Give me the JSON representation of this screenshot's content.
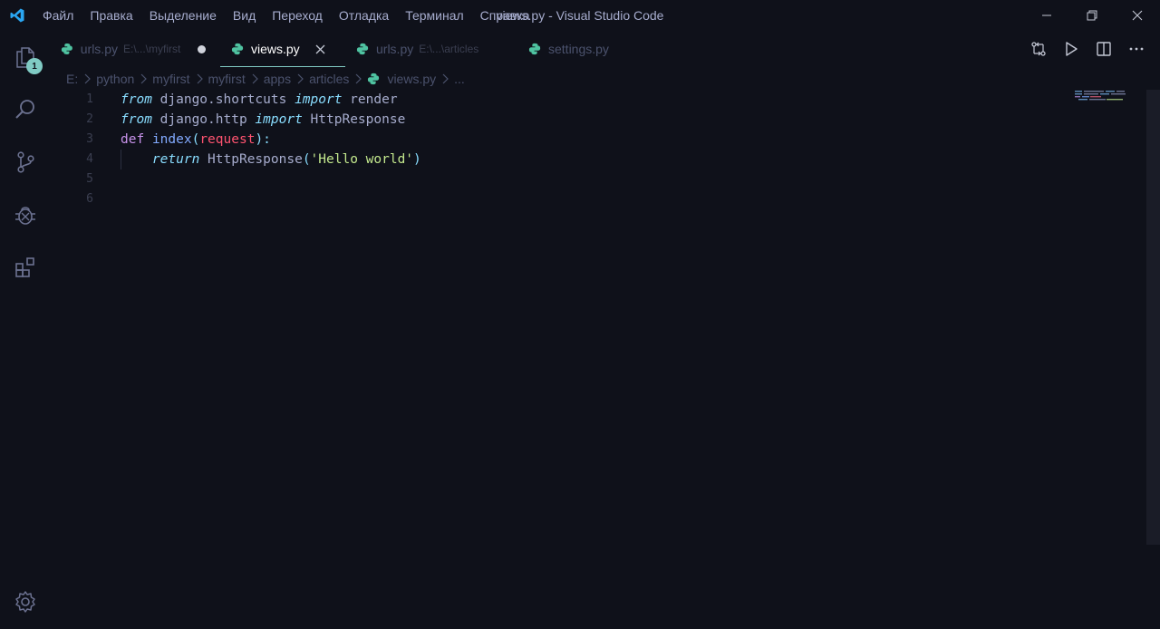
{
  "titlebar": {
    "menu": [
      "Файл",
      "Правка",
      "Выделение",
      "Вид",
      "Переход",
      "Отладка",
      "Терминал",
      "Справка"
    ],
    "title": "views.py - Visual Studio Code"
  },
  "activity": {
    "explorer_badge": "1"
  },
  "tabs": [
    {
      "label": "urls.py",
      "description": "E:\\...\\myfirst",
      "state": "dirty"
    },
    {
      "label": "views.py",
      "description": "",
      "state": "active"
    },
    {
      "label": "urls.py",
      "description": "E:\\...\\articles",
      "state": "normal"
    },
    {
      "label": "settings.py",
      "description": "",
      "state": "normal"
    }
  ],
  "breadcrumb": [
    "E:",
    "python",
    "myfirst",
    "myfirst",
    "apps",
    "articles",
    "views.py",
    "..."
  ],
  "editor": {
    "line_numbers": [
      "1",
      "2",
      "3",
      "4",
      "5",
      "6"
    ],
    "lines": [
      {
        "t1": "from",
        "t2": " django.shortcuts ",
        "t3": "import",
        "t4": " render"
      },
      {
        "t1": "from",
        "t2": " django.http ",
        "t3": "import",
        "t4": " HttpResponse"
      },
      {
        "t1": "def",
        "t2": " ",
        "t3": "index",
        "t4": "(",
        "t5": "request",
        "t6": "):"
      },
      {
        "t0": "    ",
        "t1": "return",
        "t2": " HttpResponse",
        "t3": "(",
        "t4": "'Hello world'",
        "t5": ")"
      }
    ]
  },
  "colors": {
    "accent": "#80cbc4",
    "background": "#0f111a",
    "python_icon": "#4fc3a1"
  }
}
